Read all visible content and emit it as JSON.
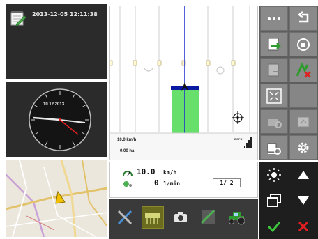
{
  "status": {
    "datetime": "2013-12-05 12:11:38",
    "clock_date": "10.12.2013"
  },
  "field": {
    "speed": "10.0 km/h",
    "area": "0.00 ha",
    "gps_mode": "DGPS"
  },
  "info": {
    "speed_value": "10.0",
    "speed_unit": "km/h",
    "rpm_value": "0",
    "rpm_unit": "1/min",
    "page_indicator": "1/ 2"
  },
  "softkeys": [
    {
      "name": "more-options",
      "icon": "ellipsis-icon"
    },
    {
      "name": "back",
      "icon": "return-arrow-icon"
    },
    {
      "name": "import-task",
      "icon": "document-import-icon"
    },
    {
      "name": "stop",
      "icon": "stop-icon"
    },
    {
      "name": "export-task",
      "icon": "document-export-icon"
    },
    {
      "name": "clear-track",
      "icon": "track-delete-icon"
    },
    {
      "name": "fullscreen",
      "icon": "fullscreen-icon"
    },
    {
      "name": "empty",
      "icon": ""
    },
    {
      "name": "machine-settings",
      "icon": "machine-gear-icon"
    },
    {
      "name": "map-view",
      "icon": "map-icon"
    },
    {
      "name": "implement-settings",
      "icon": "implement-gear-icon"
    },
    {
      "name": "settings",
      "icon": "gear-icon"
    }
  ],
  "nav": {
    "brightness": "brightness-icon",
    "up": "arrow-up-icon",
    "switch_view": "window-switch-icon",
    "down": "arrow-down-icon",
    "confirm": "checkmark-icon",
    "cancel": "cancel-icon"
  },
  "colors": {
    "tile_bg": "#2b2b2b",
    "softkey_bg": "#8a8a8a",
    "track_line": "#1a2bd0",
    "worked_area": "#66e06a",
    "confirm": "#3cc43c",
    "cancel": "#e02020"
  }
}
